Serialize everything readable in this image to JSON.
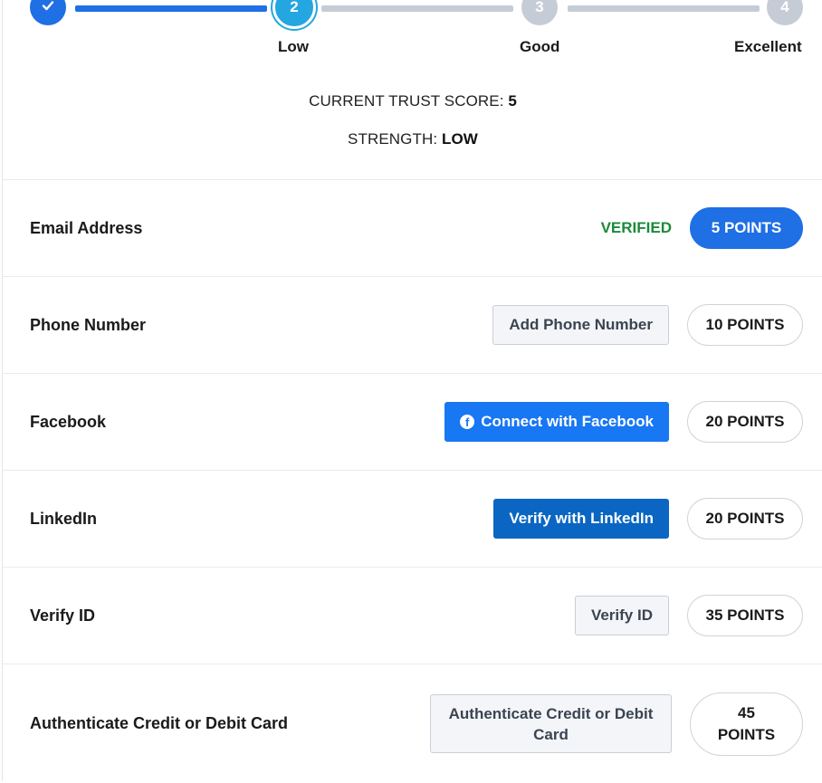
{
  "stepper": {
    "steps": [
      {
        "number": "✓",
        "state": "complete"
      },
      {
        "number": "2",
        "state": "current"
      },
      {
        "number": "3",
        "state": "upcoming"
      },
      {
        "number": "4",
        "state": "upcoming"
      }
    ],
    "labels": [
      "Low",
      "Good",
      "Excellent"
    ]
  },
  "summary": {
    "score_label": "CURRENT TRUST SCORE:",
    "score_value": "5",
    "strength_label": "STRENGTH:",
    "strength_value": "LOW"
  },
  "rows": [
    {
      "label": "Email Address",
      "status": "VERIFIED",
      "points": "5 POINTS"
    },
    {
      "label": "Phone Number",
      "action": "Add Phone Number",
      "points": "10 POINTS"
    },
    {
      "label": "Facebook",
      "action": "Connect with Facebook",
      "points": "20 POINTS"
    },
    {
      "label": "LinkedIn",
      "action": "Verify with LinkedIn",
      "points": "20 POINTS"
    },
    {
      "label": "Verify ID",
      "action": "Verify ID",
      "points": "35 POINTS"
    },
    {
      "label": "Authenticate Credit or Debit Card",
      "action": "Authenticate Credit or Debit Card",
      "points": "45 POINTS"
    }
  ],
  "colors": {
    "primary": "#1f6fe5",
    "current_step": "#24a6e0",
    "upcoming": "#c5ccd5",
    "verified": "#1b8a3a",
    "facebook": "#1877f2",
    "linkedin": "#0a66c2"
  },
  "icons": {
    "step1": "check-icon",
    "facebook": "facebook-icon"
  }
}
